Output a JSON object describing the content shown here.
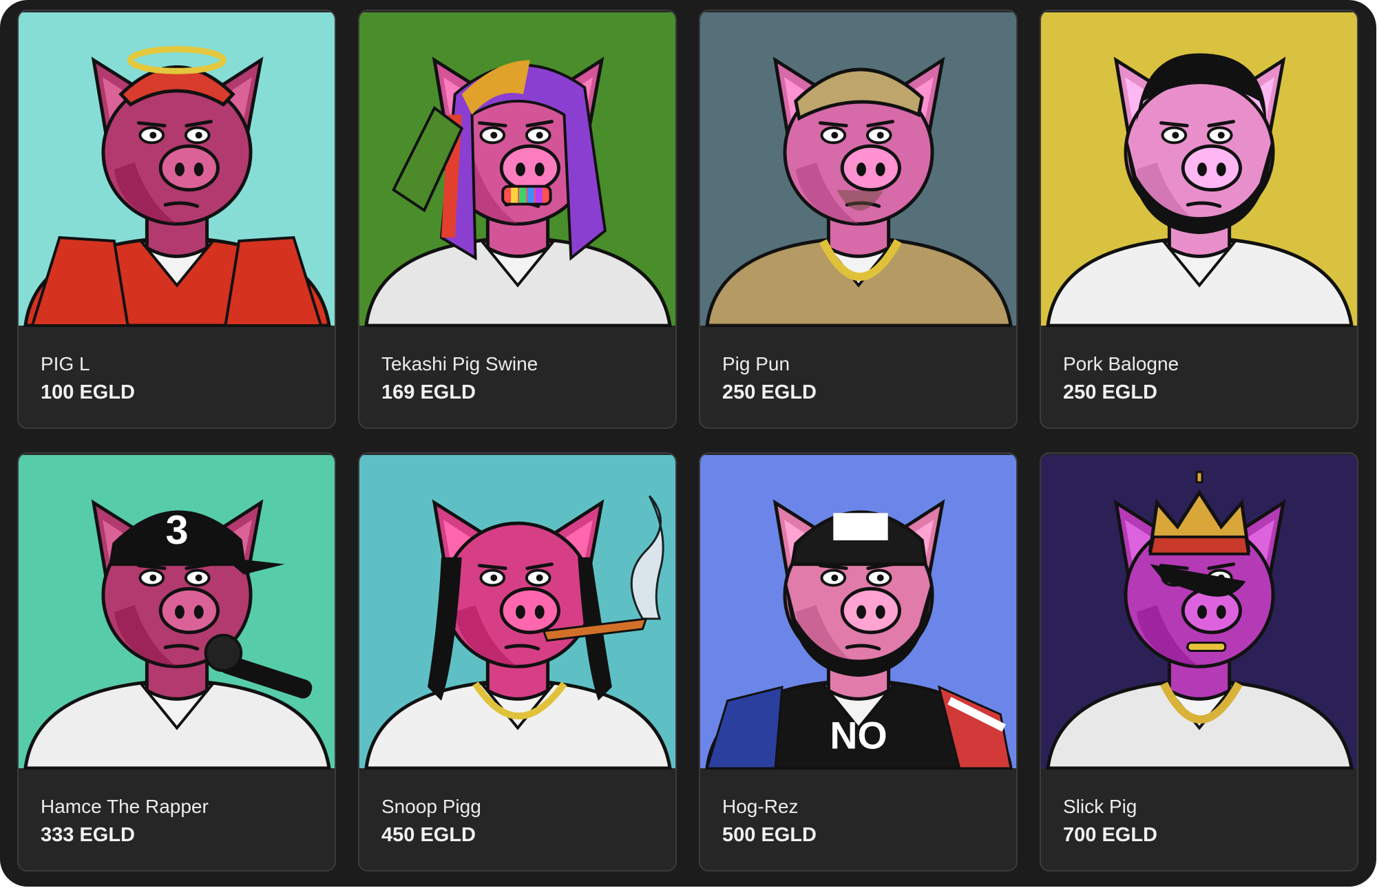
{
  "gallery": {
    "items": [
      {
        "name": "PIG L",
        "price": "100 EGLD",
        "bg": "#86ddd6",
        "skin": "#b23a6e",
        "outfit": "#d5321f",
        "hat": "#d73c2c",
        "accessory": "halo",
        "art_icon": "pig-avatar-icon"
      },
      {
        "name": "Tekashi Pig Swine",
        "price": "169 EGLD",
        "bg": "#4a8e2b",
        "skin": "#d35597",
        "outfit": "#e6e6e6",
        "hat": "#c4307a",
        "accessory": "rainbow-hair",
        "art_icon": "pig-avatar-icon"
      },
      {
        "name": "Pig Pun",
        "price": "250 EGLD",
        "bg": "#56707a",
        "skin": "#d76aa8",
        "outfit": "#b59a64",
        "hat": "#bda56b",
        "accessory": "gold-chain",
        "art_icon": "pig-avatar-icon"
      },
      {
        "name": "Pork Balogne",
        "price": "250 EGLD",
        "bg": "#d9c23f",
        "skin": "#e88fcb",
        "outfit": "#f0f0f0",
        "hat": "#111111",
        "accessory": "beard",
        "art_icon": "pig-avatar-icon"
      },
      {
        "name": "Hamce The Rapper",
        "price": "333 EGLD",
        "bg": "#57cca8",
        "skin": "#b23a6e",
        "outfit": "#eeeeee",
        "hat": "#111111",
        "accessory": "microphone",
        "art_icon": "pig-avatar-icon"
      },
      {
        "name": "Snoop Pigg",
        "price": "450 EGLD",
        "bg": "#5ec0c5",
        "skin": "#d63f85",
        "outfit": "#f0f0f0",
        "hat": "#111111",
        "accessory": "smoke",
        "art_icon": "pig-avatar-icon"
      },
      {
        "name": "Hog-Rez",
        "price": "500 EGLD",
        "bg": "#6b86e8",
        "skin": "#e07baa",
        "outfit": "#151515",
        "hat": "#1a1a1a",
        "accessory": "flag",
        "art_icon": "pig-avatar-icon"
      },
      {
        "name": "Slick Pig",
        "price": "700 EGLD",
        "bg": "#2b2156",
        "skin": "#b43ab6",
        "outfit": "#e8e8e8",
        "hat": "#d9a63a",
        "accessory": "crown",
        "art_icon": "pig-avatar-icon"
      }
    ]
  }
}
